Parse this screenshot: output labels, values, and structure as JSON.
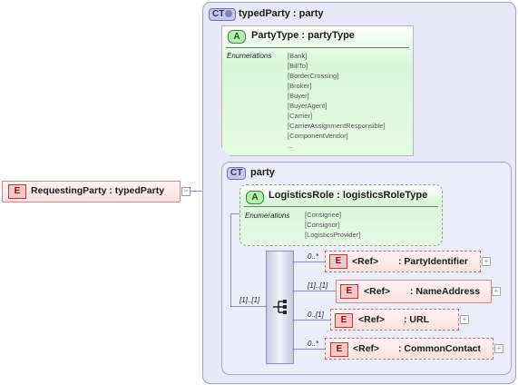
{
  "requesting": {
    "badge": "E",
    "label": "RequestingParty : typedParty",
    "toggle": "−"
  },
  "outer_type": {
    "badge": "CT",
    "icon": "plus-glyph",
    "title": "typedParty : party"
  },
  "party_type_attr": {
    "badge": "A",
    "title": "PartyType : partyType",
    "enum_label": "Enumerations",
    "items": [
      "[Bank]",
      "[BillTo]",
      "[BorderCrossing]",
      "[Broker]",
      "[Buyer]",
      "[BuyerAgent]",
      "[Carrier]",
      "[CarrierAssignmentResponsible]",
      "[ComponentVendor]",
      "..."
    ]
  },
  "inner_type": {
    "badge": "CT",
    "title": "party"
  },
  "logistics_attr": {
    "badge": "A",
    "title": "LogisticsRole : logisticsRoleType",
    "enum_label": "Enumerations",
    "items": [
      "[Consignee]",
      "[Consignor]",
      "[LogisticsProvider]"
    ]
  },
  "sequence": {
    "cardinality": "[1]..[1]",
    "icon": "sequence-icon"
  },
  "children": [
    {
      "card": "0..*",
      "badge": "E",
      "ref": "<Ref>",
      "name": ": PartyIdentifier",
      "expand": "+"
    },
    {
      "card": "[1]..[1]",
      "badge": "E",
      "ref": "<Ref>",
      "name": ": NameAddress",
      "expand": "+"
    },
    {
      "card": "0..[1]",
      "badge": "E",
      "ref": "<Ref>",
      "name": ": URL",
      "expand": "+"
    },
    {
      "card": "0..*",
      "badge": "E",
      "ref": "<Ref>",
      "name": ": CommonContact",
      "expand": "+"
    }
  ],
  "colors": {
    "element_fill": "#fde0e0",
    "attribute_fill": "#d8f8d8",
    "complex_type_fill": "#e8e8f8",
    "connector": "#8c8cb8"
  }
}
